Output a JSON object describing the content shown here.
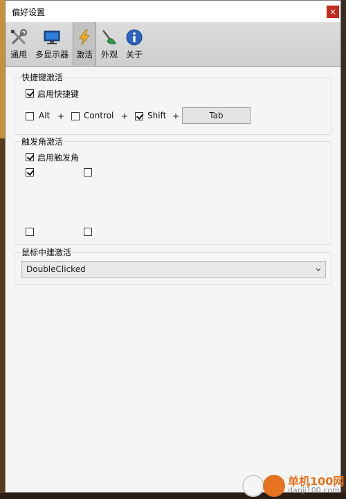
{
  "window": {
    "title": "偏好设置",
    "close_label": "×"
  },
  "toolbar": {
    "items": [
      {
        "label": "通用",
        "icon": "tools-icon"
      },
      {
        "label": "多显示器",
        "icon": "monitor-icon"
      },
      {
        "label": "激活",
        "icon": "lightning-icon",
        "active": true
      },
      {
        "label": "外观",
        "icon": "brush-icon"
      },
      {
        "label": "关于",
        "icon": "info-icon"
      }
    ]
  },
  "hotkey_group": {
    "title": "快捷键激活",
    "enable_label": "启用快捷键",
    "enable_checked": true,
    "alt_label": "Alt",
    "alt_checked": false,
    "control_label": "Control",
    "control_checked": false,
    "shift_label": "Shift",
    "shift_checked": true,
    "plus": "+",
    "key_value": "Tab"
  },
  "corner_group": {
    "title": "触发角激活",
    "enable_label": "启用触发角",
    "enable_checked": true,
    "corners": {
      "top_left": true,
      "top_right": false,
      "bottom_left": false,
      "bottom_right": false
    }
  },
  "mouse_group": {
    "title": "鼠标中建激活",
    "selected": "DoubleClicked"
  },
  "watermark": {
    "line1": "单机100网",
    "line2": "danji100.com"
  },
  "colors": {
    "accent": "#c42b1c",
    "watermark": "#e6731f"
  }
}
